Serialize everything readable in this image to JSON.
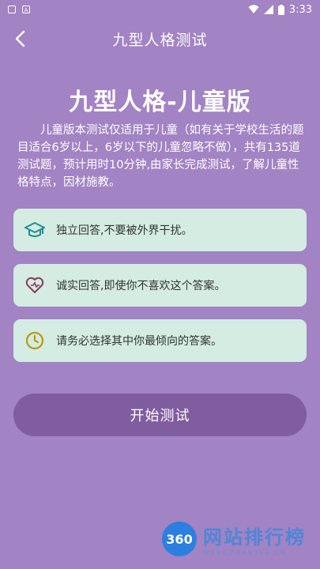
{
  "status_bar": {
    "left_icons": [
      "notification-icon",
      "app-a-icon"
    ],
    "time": "3:33",
    "right_icons": [
      "wifi-icon",
      "signal-icon",
      "battery-icon"
    ]
  },
  "nav": {
    "title": "九型人格测试",
    "back_icon": "chevron-left-icon"
  },
  "main_title": "九型人格-儿童版",
  "intro_text": "儿童版本测试仅适用于儿童（如有关于学校生活的题目适合6岁以上，6岁以下的儿童忽略不做），共有135道测试题，预计用时10分钟,由家长完成测试，了解儿童性格特点，因材施教。",
  "tips": [
    {
      "icon": "graduation-cap-icon",
      "text": "独立回答,不要被外界干扰。",
      "color": "#1f8f8f"
    },
    {
      "icon": "heart-icon",
      "text": "诚实回答,即使你不喜欢这个答案。",
      "color": "#8a3a5a"
    },
    {
      "icon": "clock-icon",
      "text": "请务必选择其中你最倾向的答案。",
      "color": "#b89a10"
    }
  ],
  "start_button": "开始测试",
  "colors": {
    "background": "#a283c3",
    "card": "#d4ece2",
    "button": "#7f5d9f"
  },
  "watermark": {
    "logo": "360",
    "title": "网站排行榜",
    "subtitle": "WANGZHAN360.CN"
  }
}
